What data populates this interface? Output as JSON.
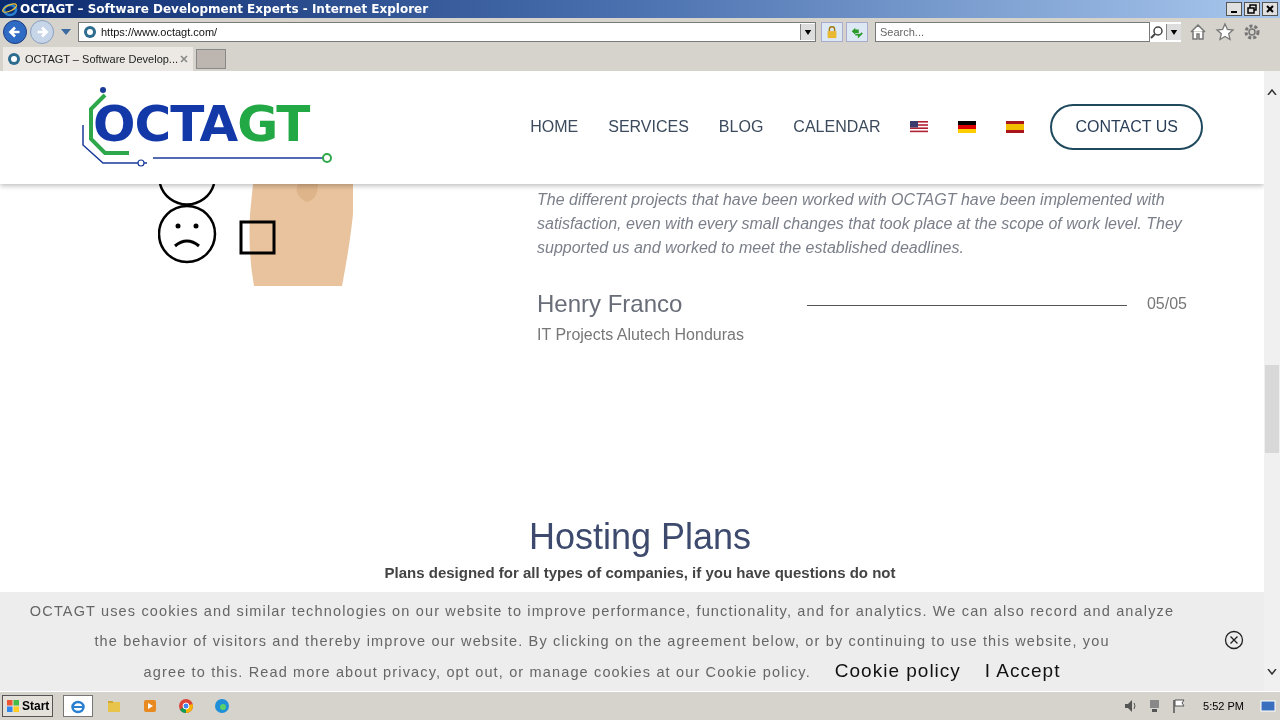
{
  "window": {
    "title": "OCTAGT – Software Development Experts - Internet Explorer"
  },
  "browser": {
    "address": "https://www.octagt.com/",
    "search_placeholder": "Search...",
    "tabs": [
      {
        "label": "OCTAGT – Software Develop...",
        "selected": true
      }
    ]
  },
  "site": {
    "logo": [
      "OCTA",
      "GT"
    ],
    "nav": [
      {
        "label": "HOME"
      },
      {
        "label": "SERVICES"
      },
      {
        "label": "BLOG"
      },
      {
        "label": "CALENDAR"
      }
    ],
    "flags": [
      {
        "kind": "us"
      },
      {
        "kind": "de"
      },
      {
        "kind": "es"
      }
    ],
    "contact": "CONTACT US"
  },
  "testimonial": {
    "quote": "The different projects that have been worked with OCTAGT have been implemented with satisfaction, even with every small changes that took place at the scope of work level. They supported us and worked to meet the established deadlines.",
    "name": "Henry Franco",
    "counter": "05/05",
    "role": "IT Projects Alutech Honduras"
  },
  "section": {
    "title": "Hosting Plans",
    "subtitle": "Plans designed for all types of companies, if you have questions do not"
  },
  "cookie": {
    "text": [
      "OCTAGT uses cookies and similar technologies on our website to improve performance, functionality, and for analytics. We can also record and analyze the behavior of visitors and thereby improve our website. By clicking on the agreement below, or by continuing to use this website, you",
      "agree to this. Read more about privacy, opt out, or manage cookies at our Cookie policy."
    ],
    "link": "Cookie policy",
    "accept": "I Accept"
  },
  "taskbar": {
    "start": "Start",
    "time": "5:52 PM"
  }
}
